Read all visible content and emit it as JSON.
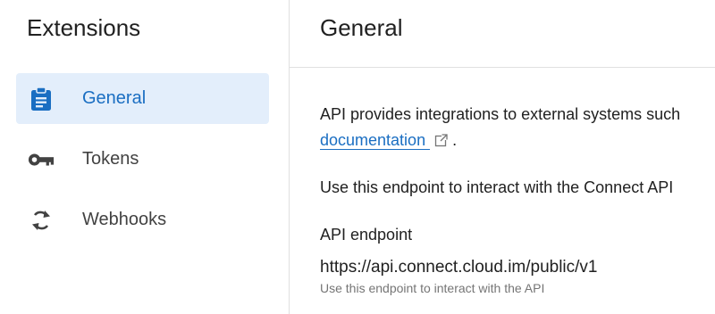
{
  "sidebar": {
    "title": "Extensions",
    "items": [
      {
        "label": "General",
        "icon": "clipboard-icon",
        "active": true
      },
      {
        "label": "Tokens",
        "icon": "key-icon",
        "active": false
      },
      {
        "label": "Webhooks",
        "icon": "sync-icon",
        "active": false
      }
    ]
  },
  "main": {
    "title": "General",
    "intro_text": "API provides integrations to external systems such",
    "doc_link_label": "documentation",
    "doc_link_suffix": ".",
    "endpoint_usage_text": "Use this endpoint to interact with the Connect API",
    "endpoint": {
      "heading": "API endpoint",
      "value": "https://api.connect.cloud.im/public/v1",
      "hint": "Use this endpoint to interact with the API"
    }
  },
  "colors": {
    "accent": "#1a6ec2",
    "active_bg": "#e3eefb",
    "icon_gray": "#424242",
    "divider": "#e0e0e0"
  }
}
